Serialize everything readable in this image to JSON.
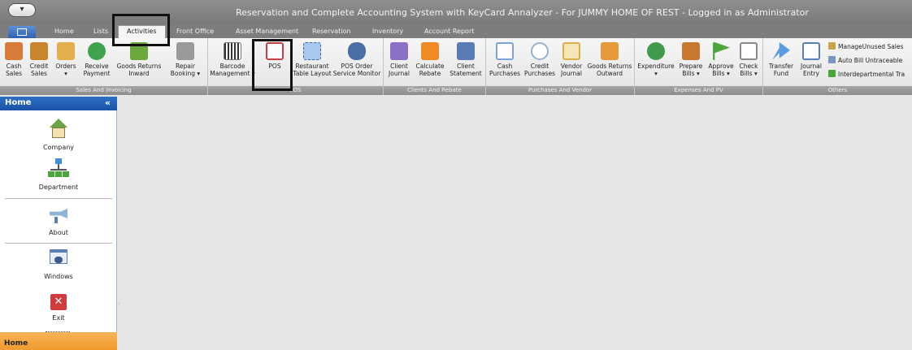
{
  "app_title": "Reservation and Complete Accounting System with KeyCard Annalyzer - For JUMMY HOME OF REST - Logged in as Administrator",
  "tabs": [
    "Home",
    "Lists",
    "Activities",
    "Front Office",
    "Asset Management",
    "Reservation",
    "Inventory",
    "Account Report"
  ],
  "active_tab": "Activities",
  "ribbon": {
    "sales": {
      "label": "Sales And Invoicing",
      "buttons": [
        {
          "l1": "Cash",
          "l2": "Sales",
          "icon": "cash-sales-icon",
          "color": "#d87a3a"
        },
        {
          "l1": "Credit",
          "l2": "Sales",
          "icon": "credit-sales-icon",
          "color": "#c9852e"
        },
        {
          "l1": "Orders",
          "l2": "▾",
          "icon": "orders-icon",
          "color": "#e4b04d"
        },
        {
          "l1": "Receive",
          "l2": "Payment",
          "icon": "receive-payment-icon",
          "color": "#3fa34d"
        },
        {
          "l1": "Goods Returns",
          "l2": "Inward",
          "icon": "goods-returns-inward-icon",
          "color": "#6aa83c"
        },
        {
          "l1": "Repair",
          "l2": "Booking ▾",
          "icon": "repair-tools-icon",
          "color": "#9a9a9a"
        }
      ]
    },
    "pos": {
      "label": "POS",
      "buttons": [
        {
          "l1": "Barcode",
          "l2": "Management ▾",
          "icon": "barcode-icon",
          "color": "#555555"
        },
        {
          "l1": "POS",
          "l2": "",
          "icon": "pos-register-icon",
          "color": "#c94040"
        },
        {
          "l1": "Restaurant",
          "l2": "Table Layout",
          "icon": "table-layout-icon",
          "color": "#6fa1e0"
        },
        {
          "l1": "POS Order",
          "l2": "Service Monitor",
          "icon": "binoculars-icon",
          "color": "#4a6ea8"
        }
      ]
    },
    "clients": {
      "label": "Clients And Rebate",
      "buttons": [
        {
          "l1": "Client",
          "l2": "Journal",
          "icon": "client-journal-icon",
          "color": "#8a6fc4"
        },
        {
          "l1": "Calculate",
          "l2": "Rebate",
          "icon": "rebate-icon",
          "color": "#f08a24"
        },
        {
          "l1": "Client",
          "l2": "Statement",
          "icon": "client-statement-icon",
          "color": "#5b7bb3"
        }
      ]
    },
    "purchases": {
      "label": "Purchases And Vendor",
      "buttons": [
        {
          "l1": "Cash",
          "l2": "Purchases",
          "icon": "cash-purchases-icon",
          "color": "#7aa4d8"
        },
        {
          "l1": "Credit",
          "l2": "Purchases",
          "icon": "credit-purchases-icon",
          "color": "#9bb2cf"
        },
        {
          "l1": "Vendor",
          "l2": "Journal",
          "icon": "vendor-journal-icon",
          "color": "#d9b04a"
        },
        {
          "l1": "Goods Returns",
          "l2": "Outward",
          "icon": "goods-returns-outward-icon",
          "color": "#e69a3c"
        }
      ]
    },
    "expenses": {
      "label": "Expenses And PV",
      "buttons": [
        {
          "l1": "Expenditure",
          "l2": "▾",
          "icon": "expenditure-icon",
          "color": "#3f9b4b"
        },
        {
          "l1": "Prepare",
          "l2": "Bills ▾",
          "icon": "prepare-bills-icon",
          "color": "#c6782f"
        },
        {
          "l1": "Approve",
          "l2": "Bills ▾",
          "icon": "approve-flag-icon",
          "color": "#4aa63a"
        },
        {
          "l1": "Check",
          "l2": "Bills ▾",
          "icon": "check-bills-icon",
          "color": "#8a8a8a"
        }
      ]
    },
    "others": {
      "label": "Others",
      "buttons": [
        {
          "l1": "Transfer",
          "l2": "Fund",
          "icon": "transfer-arrow-icon",
          "color": "#5b9be0"
        },
        {
          "l1": "Journal",
          "l2": "Entry",
          "icon": "journal-entry-icon",
          "color": "#5a7fb5"
        }
      ],
      "small_items": [
        "ManageUnused Sales",
        "Auto Bill Untraceable",
        "Interdepartmental Tra"
      ]
    }
  },
  "sidebar": {
    "title": "Home",
    "collapse": "«",
    "items": [
      "Company",
      "Department",
      "About",
      "Windows",
      "Exit"
    ],
    "footer": "Home"
  }
}
